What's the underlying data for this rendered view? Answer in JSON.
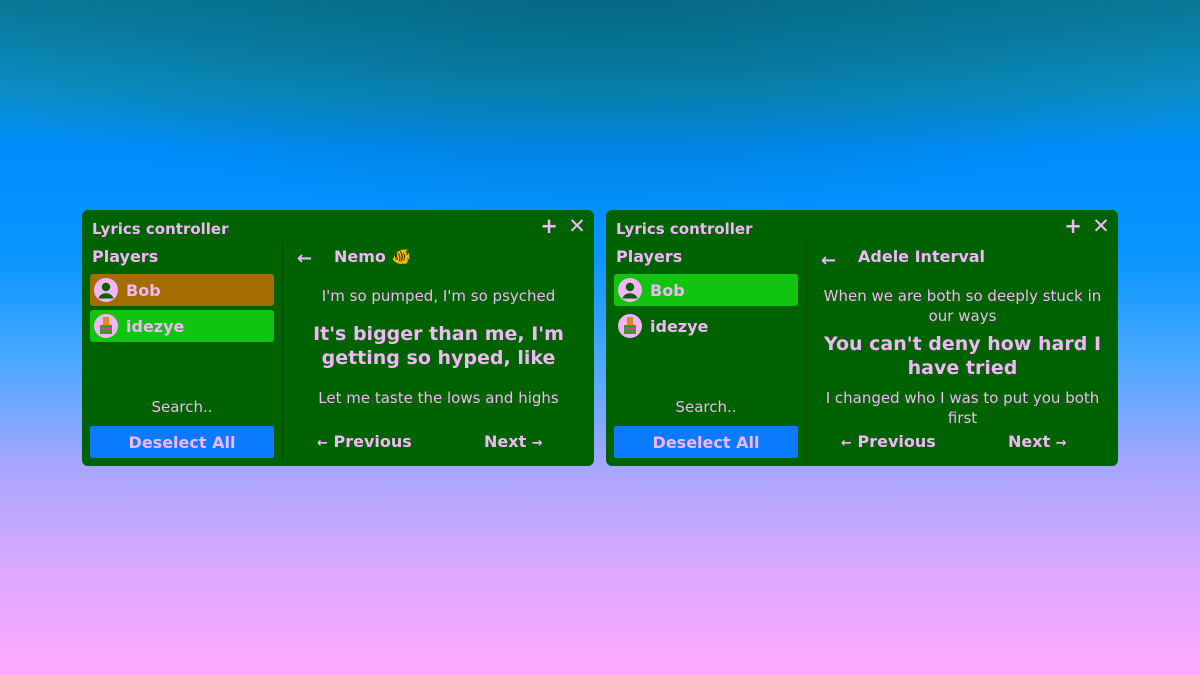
{
  "colors": {
    "panel_bg": "#006200",
    "text": "#f3b6f8",
    "button_blue": "#0a7aff",
    "selected_orange": "#a36d00",
    "selected_green": "#10c410"
  },
  "windows": [
    {
      "title": "Lyrics controller",
      "add_icon": "plus-icon",
      "close_icon": "close-icon",
      "players_label": "Players",
      "players": [
        {
          "name": "Bob",
          "avatar": "default-user-avatar",
          "highlight": "#a36d00"
        },
        {
          "name": "idezye",
          "avatar": "custom-avatar",
          "highlight": "#10c410"
        }
      ],
      "search_placeholder": "Search..",
      "deselect_label": "Deselect All",
      "back_icon": "arrow-left-icon",
      "song_title": "Nemo 🐠",
      "lyrics": {
        "previous_line": "I'm so pumped, I'm so psyched",
        "current_line": "It's bigger than me, I'm getting so hyped, like",
        "next_line": "Let me taste the lows and highs"
      },
      "previous_label": "Previous",
      "next_label": "Next"
    },
    {
      "title": "Lyrics controller",
      "add_icon": "plus-icon",
      "close_icon": "close-icon",
      "players_label": "Players",
      "players": [
        {
          "name": "Bob",
          "avatar": "default-user-avatar",
          "highlight": "#10c410"
        },
        {
          "name": "idezye",
          "avatar": "custom-avatar",
          "highlight": "none"
        }
      ],
      "search_placeholder": "Search..",
      "deselect_label": "Deselect All",
      "back_icon": "arrow-left-icon",
      "song_title": "Adele Interval",
      "lyrics": {
        "previous_line": "When we are both so deeply stuck in our ways",
        "current_line": "You can't deny how hard I have tried",
        "next_line": "I changed who I was to put you both first"
      },
      "previous_label": "Previous",
      "next_label": "Next"
    }
  ]
}
